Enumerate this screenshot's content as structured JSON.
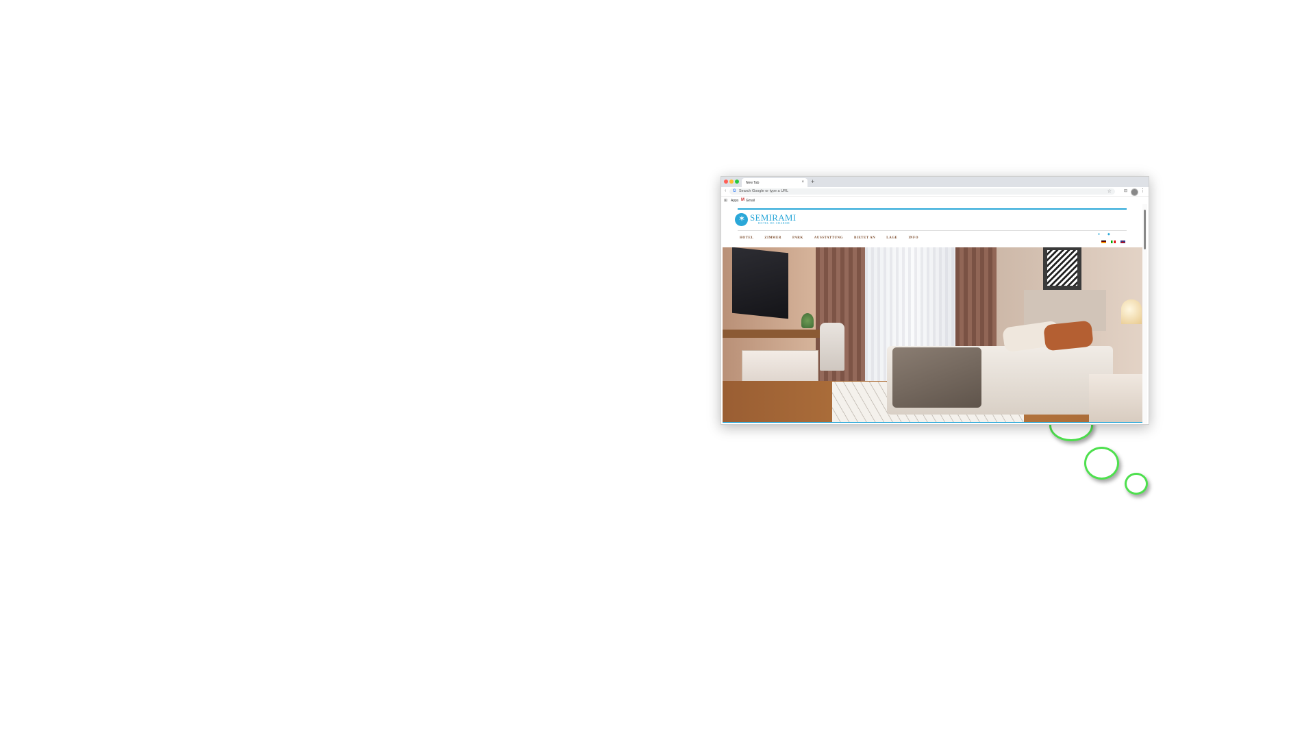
{
  "browser": {
    "tab_title": "New Tab",
    "tab_close": "×",
    "new_tab": "+",
    "back": "‹",
    "omnibox_placeholder": "Search Google or type a URL",
    "star": "☆",
    "bookmarks": [
      {
        "label": "Apps",
        "icon": "apps-grid-icon"
      },
      {
        "label": "Gmail",
        "icon": "gmail-icon"
      }
    ]
  },
  "site": {
    "brand": "SEMIRAMI",
    "tagline": "HOTEL DE CHARME",
    "accent_color": "#2aa7d8",
    "menu": [
      "HOTEL",
      "ZIMMER",
      "PARK",
      "AUSSTATTUNG",
      "BIETET AN",
      "LAGE",
      "INFO"
    ],
    "social": [
      "facebook-icon",
      "twitter-icon"
    ],
    "languages": [
      "de",
      "it",
      "en"
    ],
    "hero_image": "hotel-room-photo"
  }
}
